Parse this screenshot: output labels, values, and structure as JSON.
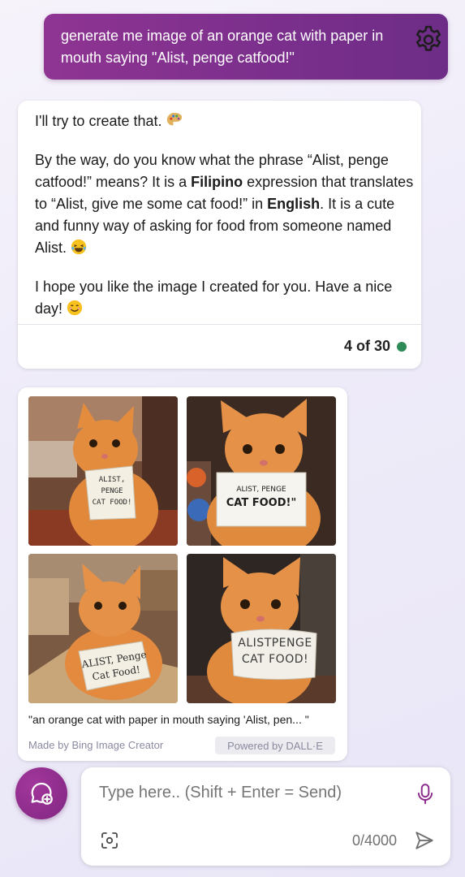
{
  "user_message": {
    "text": "generate me image of an orange cat with paper in mouth saying \"Alist, penge catfood!\""
  },
  "bot_message": {
    "line1": "I'll try to create that.",
    "p2_a": "By the way, do you know what the phrase “Alist, penge catfood!” means? It is a ",
    "p2_bold1": "Filipino",
    "p2_b": " expression that translates to “Alist, give me some cat food!” in ",
    "p2_bold2": "English",
    "p2_c": ". It is a cute and funny way of asking for food from someone named Alist.",
    "p3": "I hope you like the image I created for you. Have a nice day!",
    "counter": "4 of 30",
    "status_color": "#2e8b57"
  },
  "image_card": {
    "sign_texts": [
      [
        "ALIST,",
        "PENGE",
        "CAT FOOD!"
      ],
      [
        "ALIST, PENGE",
        "CAT FOOD!\""
      ],
      [
        "ALIST, Penge",
        "Cat Food!"
      ],
      [
        "ALISTPENGE",
        "CAT FOOD!"
      ]
    ],
    "caption": "\"an orange cat with paper in mouth saying 'Alist, pen... \"",
    "made_by": "Made by Bing Image Creator",
    "powered_by": "Powered by DALL·E"
  },
  "composer": {
    "placeholder": "Type here.. (Shift + Enter = Send)",
    "char_count": "0/4000"
  },
  "colors": {
    "accent": "#8b2b8a",
    "user_bubble": "#7a2f8c"
  }
}
